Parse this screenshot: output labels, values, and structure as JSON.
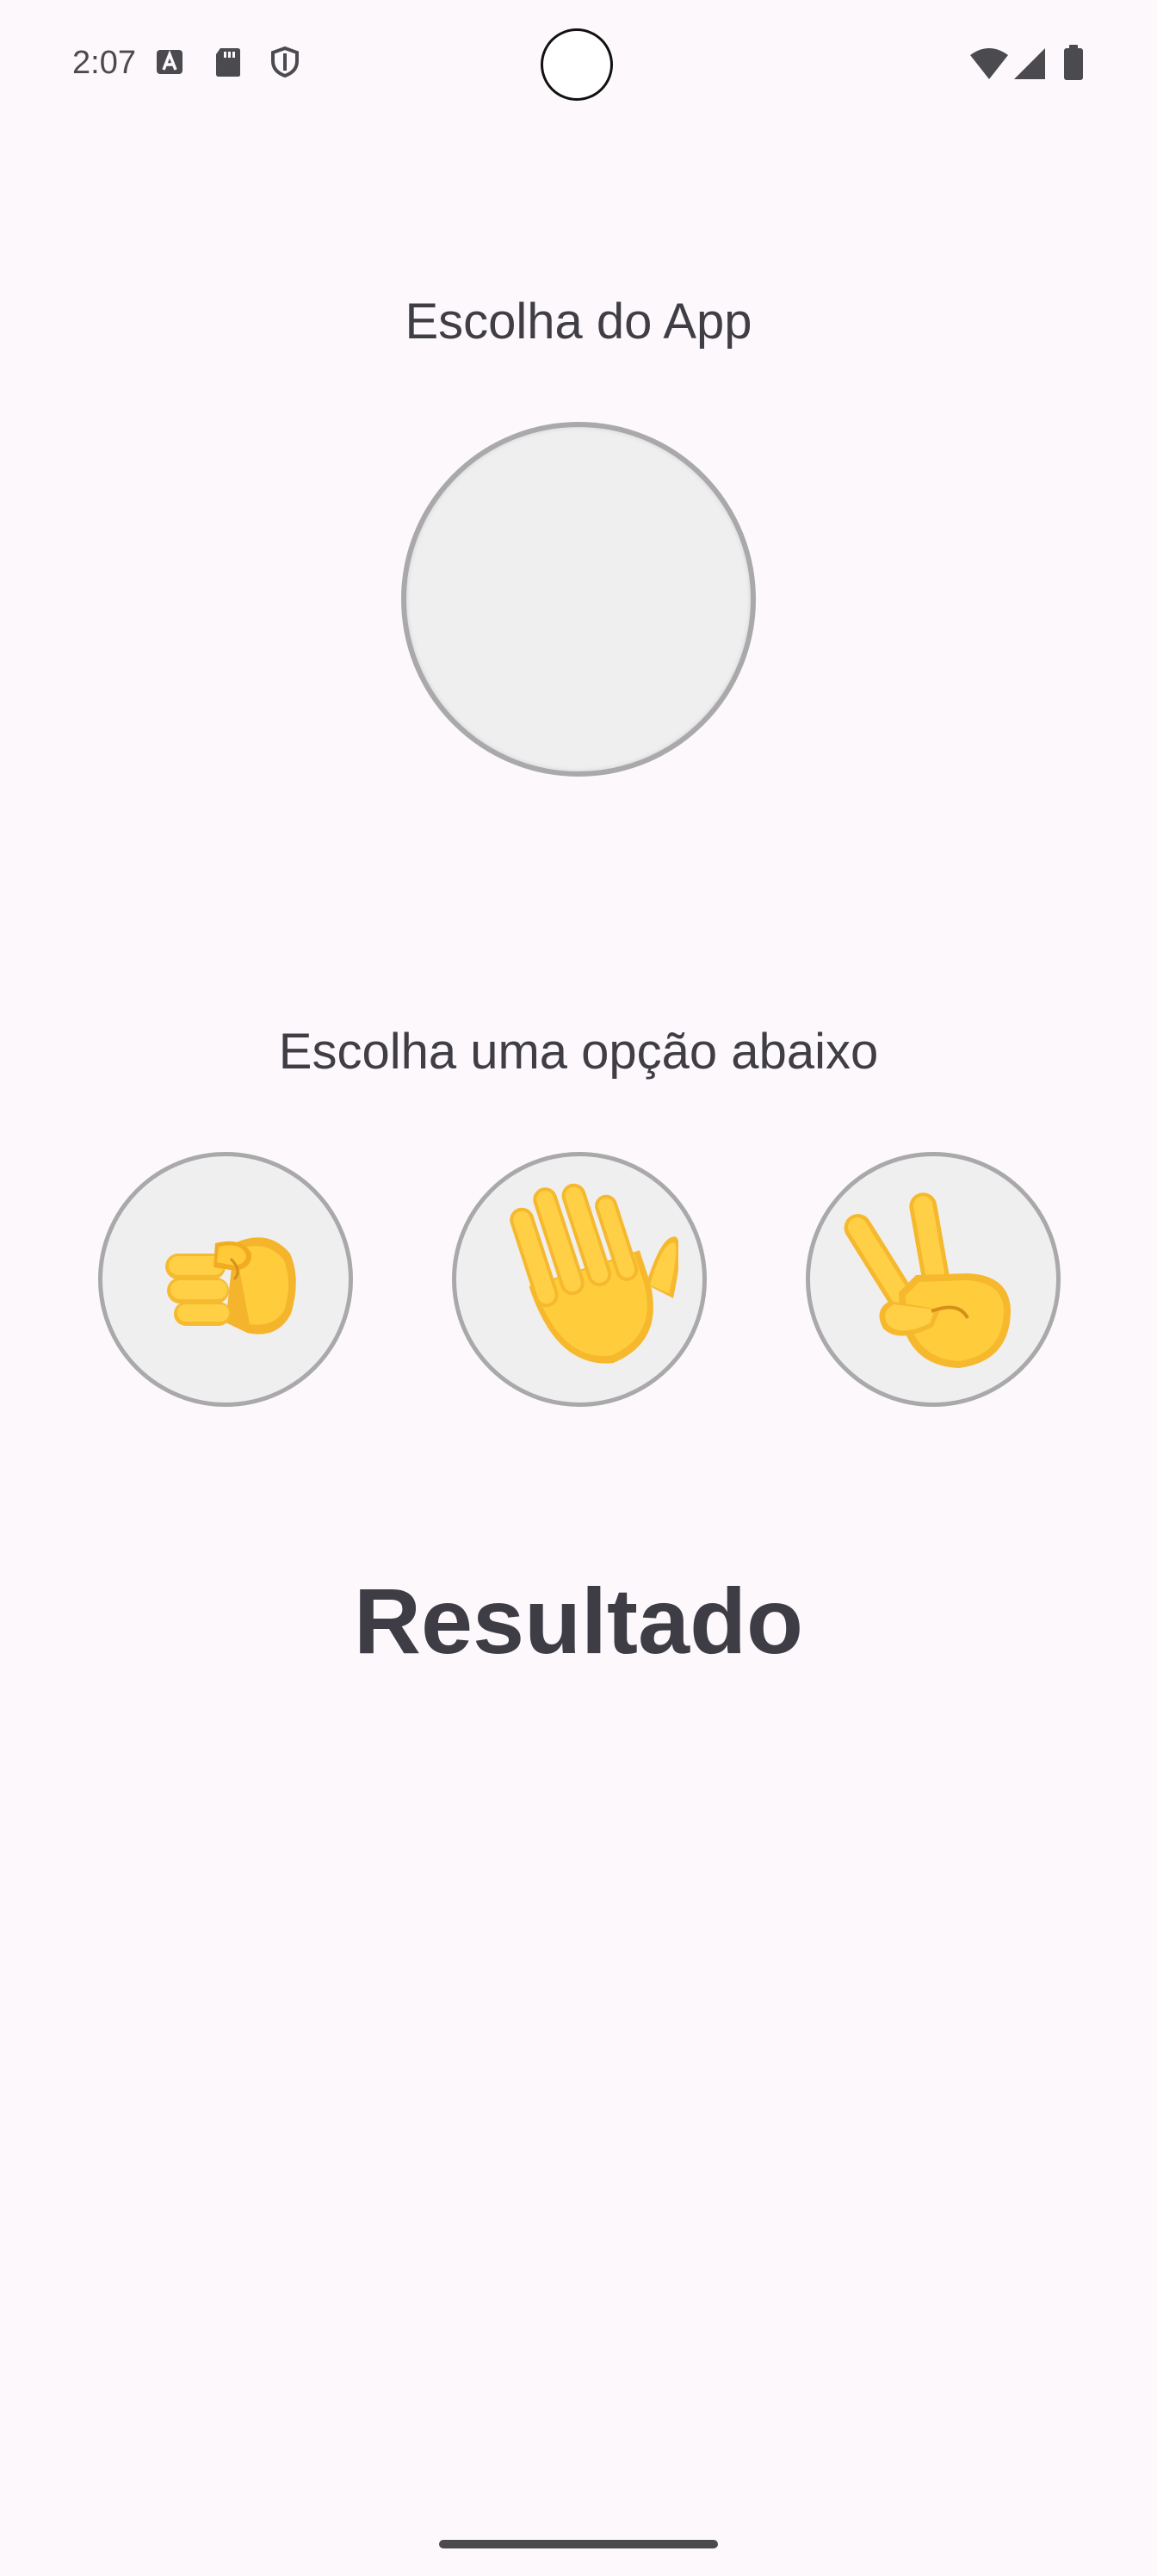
{
  "status_bar": {
    "time": "2:07",
    "left_icons": [
      "font-a-icon",
      "sd-card-icon",
      "shield-icon"
    ],
    "right_icons": [
      "wifi-icon",
      "signal-icon",
      "battery-icon"
    ]
  },
  "app_choice": {
    "heading": "Escolha do App"
  },
  "player": {
    "heading": "Escolha uma opção abaixo",
    "options": [
      {
        "name": "pedra",
        "icon": "fist-icon"
      },
      {
        "name": "papel",
        "icon": "raised-hand-icon"
      },
      {
        "name": "tesoura",
        "icon": "victory-hand-icon"
      }
    ]
  },
  "result": {
    "label": "Resultado"
  },
  "colors": {
    "background": "#fdf8fb",
    "text": "#3f3e45",
    "circle_fill": "#efeff0",
    "circle_border": "#a9a9ab",
    "emoji_yellow": "#f7c43a"
  }
}
